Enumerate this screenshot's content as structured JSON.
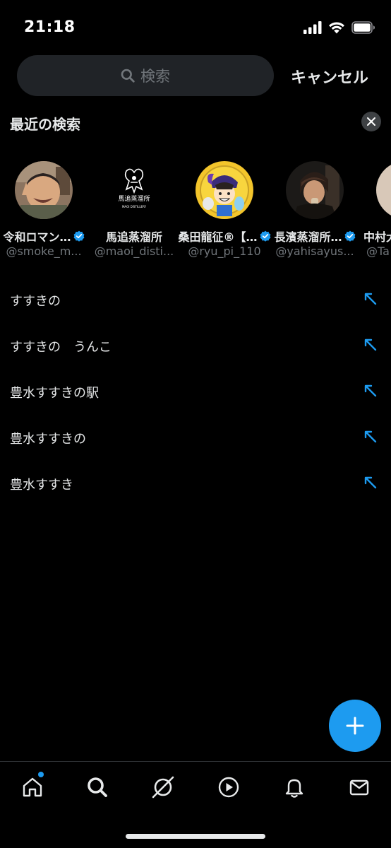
{
  "status_bar": {
    "time": "21:18"
  },
  "search": {
    "placeholder": "検索",
    "cancel_label": "キャンセル"
  },
  "recent": {
    "title": "最近の検索",
    "users": [
      {
        "name": "令和ロマン…",
        "handle": "@smoke_m...",
        "verified": true
      },
      {
        "name": "馬追蒸溜所",
        "handle": "@maoi_disti...",
        "verified": false,
        "logo_text": "馬追蒸溜所",
        "logo_subtext": "MAOI DISTILLERY"
      },
      {
        "name": "桑田龍征®【…",
        "handle": "@ryu_pi_110",
        "verified": true
      },
      {
        "name": "長濱蒸溜所…",
        "handle": "@yahisayus...",
        "verified": true
      },
      {
        "name": "中村大",
        "handle": "@Ta",
        "verified": false
      }
    ],
    "queries": [
      {
        "text": "すすきの"
      },
      {
        "text": "すすきの　うんこ"
      },
      {
        "text": "豊水すすきの駅"
      },
      {
        "text": "豊水すすきの"
      },
      {
        "text": "豊水すすき"
      }
    ]
  },
  "colors": {
    "accent": "#1d9bf0",
    "background": "#000000",
    "search_bg": "#202327",
    "secondary_text": "#71767b"
  },
  "nav": {
    "items": [
      {
        "icon": "home-icon",
        "has_badge": true
      },
      {
        "icon": "search-icon"
      },
      {
        "icon": "grok-icon"
      },
      {
        "icon": "video-icon"
      },
      {
        "icon": "bell-icon"
      },
      {
        "icon": "mail-icon"
      }
    ]
  }
}
